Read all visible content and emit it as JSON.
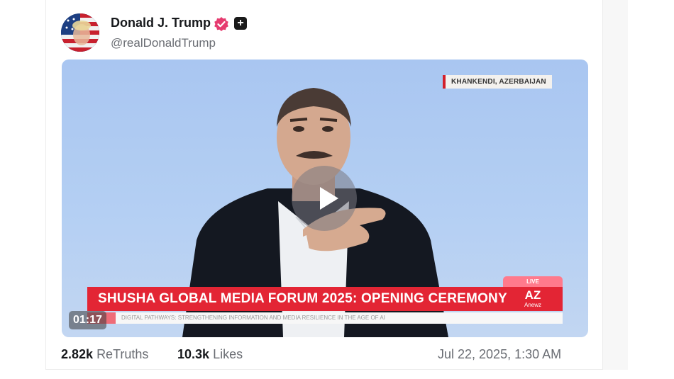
{
  "author": {
    "display_name": "Donald J. Trump",
    "handle": "@realDonaldTrump",
    "verified_color": "#e63b6f"
  },
  "media": {
    "location": "KHANKENDI, AZERBAIJAN",
    "live_label": "LIVE",
    "headline": "SHUSHA GLOBAL MEDIA FORUM 2025: OPENING CEREMONY",
    "ticker": "DIGITAL PATHWAYS: STRENGTHENING INFORMATION AND MEDIA RESILIENCE IN THE AGE OF AI",
    "network_logo": "AZ",
    "network_name": "Anewz",
    "duration": "01:17",
    "accent_color": "#e32534"
  },
  "stats": {
    "retruths_count": "2.82k",
    "retruths_label": "ReTruths",
    "likes_count": "10.3k",
    "likes_label": "Likes",
    "timestamp": "Jul 22, 2025, 1:30 AM"
  }
}
